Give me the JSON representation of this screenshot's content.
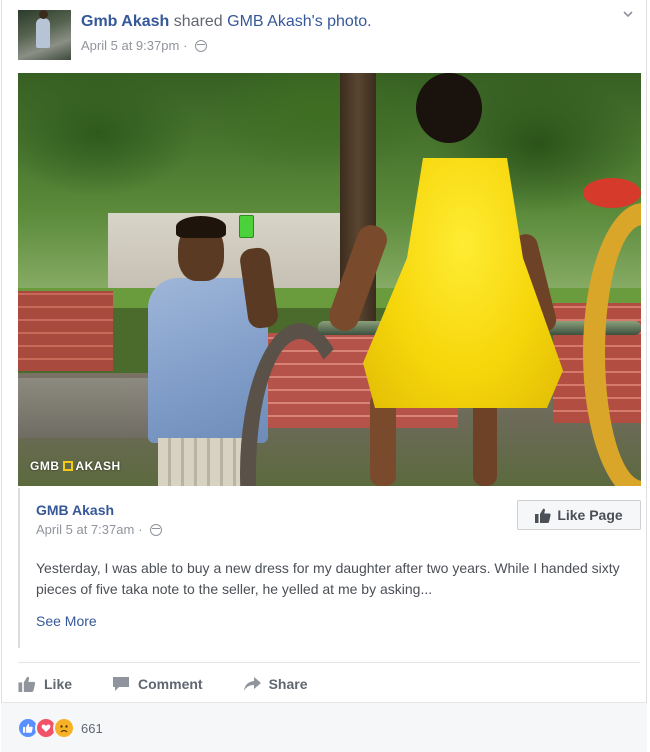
{
  "post": {
    "author": "Gmb Akash",
    "verb": "shared",
    "object": "GMB Akash's photo.",
    "timestamp": "April 5 at 9:37pm",
    "separator": "·"
  },
  "photo": {
    "watermark": "GMB",
    "watermark2": "AKASH"
  },
  "shared": {
    "page_name": "GMB Akash",
    "timestamp": "April 5 at 7:37am",
    "separator": "·",
    "like_page_label": "Like Page",
    "text": "Yesterday, I was able to buy a new dress for my daughter after two years. While I handed sixty pieces of five taka note to the seller, he yelled at me by asking...",
    "see_more": "See More"
  },
  "actions": {
    "like": "Like",
    "comment": "Comment",
    "share": "Share"
  },
  "reactions": {
    "types": [
      "like",
      "love",
      "sad"
    ],
    "count": "661"
  },
  "colors": {
    "link": "#365899",
    "muted": "#90949c",
    "action": "#616770",
    "like": "#5890ff",
    "love": "#f25268",
    "sad": "#f7b125"
  }
}
